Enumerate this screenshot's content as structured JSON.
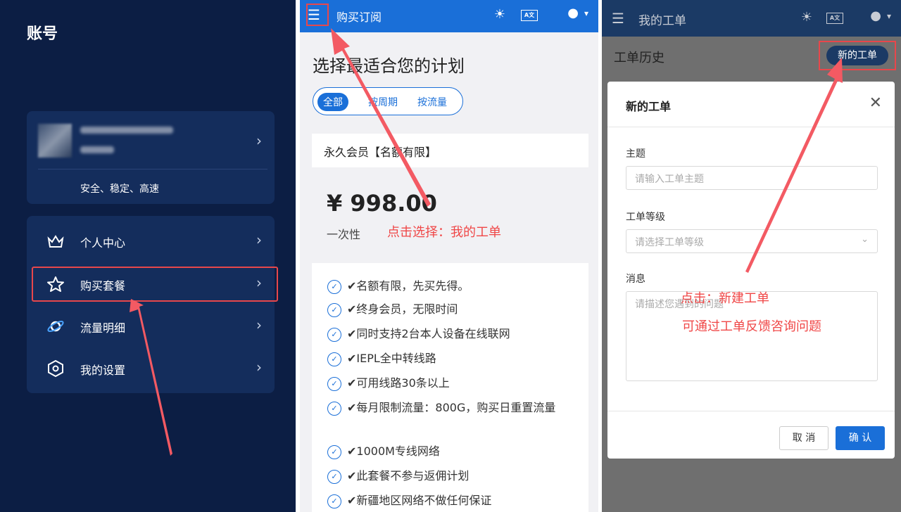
{
  "left": {
    "title": "账号",
    "slogan": "安全、稳定、高速",
    "menu": [
      "个人中心",
      "购买套餐",
      "流量明细",
      "我的设置"
    ]
  },
  "middle": {
    "bar_title": "购买订阅",
    "heading": "选择最适合您的计划",
    "tabs": [
      "全部",
      "按周期",
      "按流量"
    ],
    "plan_name": "永久会员【名额有限】",
    "price": "¥ 998.00",
    "period": "一次性",
    "annotation": "点击选择：我的工单",
    "features": [
      "✔名额有限，先买先得。",
      "✔终身会员，无限时间",
      "✔同时支持2台本人设备在线联网",
      "✔IEPL全中转线路",
      "✔可用线路30条以上",
      "✔每月限制流量：800G，购买日重置流量",
      "✔1000M专线网络",
      "✔此套餐不参与返佣计划",
      "✔新疆地区网络不做任何保证"
    ]
  },
  "right": {
    "bar_title": "我的工单",
    "history": "工单历史",
    "new_button": "新的工单",
    "modal_title": "新的工单",
    "subject_label": "主题",
    "subject_placeholder": "请输入工单主题",
    "level_label": "工单等级",
    "level_placeholder": "请选择工单等级",
    "message_label": "消息",
    "message_placeholder": "请描述您遇到的问题",
    "annotation_1": "点击：新建工单",
    "annotation_2": "可通过工单反馈咨询问题",
    "cancel": "取 消",
    "confirm": "确 认"
  },
  "colors": {
    "accent": "#1a6fd8",
    "navy": "#0c1e44",
    "annotation": "#f04747"
  }
}
